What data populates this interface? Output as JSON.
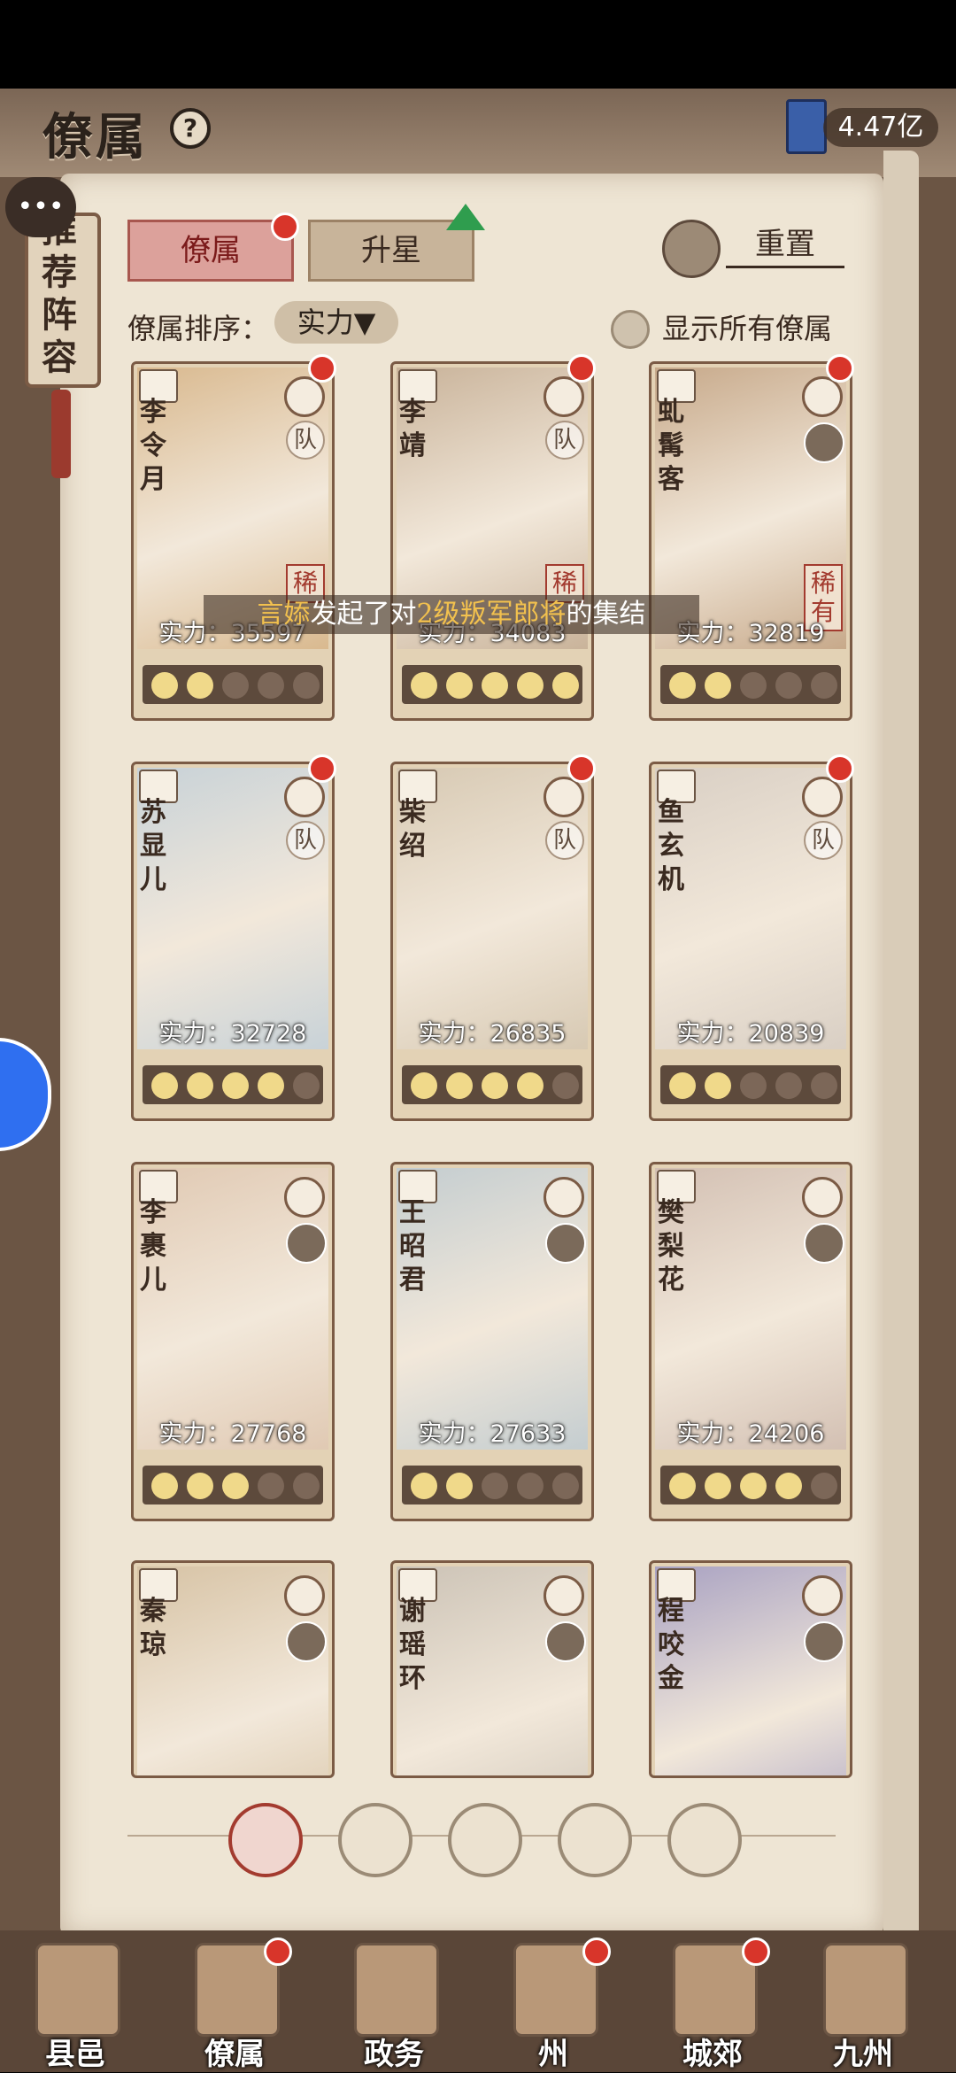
{
  "header": {
    "title": "僚属",
    "help_icon": "question-circle-icon",
    "currency_value": "4.47亿",
    "currency_icon": "book-icon"
  },
  "side": {
    "banner_text": "推荐阵容",
    "chat_icon": "chat-bubble-icon"
  },
  "tabs": [
    {
      "label": "僚属",
      "active": true
    },
    {
      "label": "升星",
      "active": false
    }
  ],
  "reset_label": "重置",
  "sort": {
    "label": "僚属排序：",
    "value": "实力▼"
  },
  "show_all_label": "显示所有僚属",
  "broadcast": {
    "user": "言婖",
    "mid1": "发起了对",
    "target": "2级叛军郎将",
    "mid2": "的集结"
  },
  "cards": [
    {
      "name": "李令月",
      "power": "实力：35597",
      "team": "队",
      "rare": "稀",
      "moons_on": 2,
      "bg": "#d9b98f"
    },
    {
      "name": "李靖",
      "power": "实力：34083",
      "team": "队",
      "rare": "稀",
      "moons_on": 5,
      "bg": "#c9b39a"
    },
    {
      "name": "虬髯客",
      "power": "实力：32819",
      "team": "",
      "rare": "稀有",
      "moons_on": 2,
      "bg": "#c7a98a"
    },
    {
      "name": "苏显儿",
      "power": "实力：32728",
      "team": "队",
      "rare": "",
      "moons_on": 4,
      "bg": "#c8d2d8"
    },
    {
      "name": "柴绍",
      "power": "实力：26835",
      "team": "队",
      "rare": "",
      "moons_on": 4,
      "bg": "#d7c9b3"
    },
    {
      "name": "鱼玄机",
      "power": "实力：20839",
      "team": "队",
      "rare": "",
      "moons_on": 2,
      "bg": "#d9cfc4"
    },
    {
      "name": "李裹儿",
      "power": "实力：27768",
      "team": "",
      "rare": "",
      "moons_on": 3,
      "bg": "#e0c9b3"
    },
    {
      "name": "王昭君",
      "power": "实力：27633",
      "team": "",
      "rare": "",
      "moons_on": 2,
      "bg": "#c4cdd0"
    },
    {
      "name": "樊梨花",
      "power": "实力：24206",
      "team": "",
      "rare": "",
      "moons_on": 4,
      "bg": "#d3c0b3"
    },
    {
      "name": "秦琼",
      "power": "",
      "team": "",
      "rare": "",
      "moons_on": 0,
      "bg": "#d7c3a5"
    },
    {
      "name": "谢瑶环",
      "power": "",
      "team": "",
      "rare": "",
      "moons_on": 0,
      "bg": "#ccc3b6"
    },
    {
      "name": "程咬金",
      "power": "",
      "team": "",
      "rare": "",
      "moons_on": 0,
      "bg": "#a9a2c2"
    }
  ],
  "filters": [
    "all-filter-icon",
    "crest-a-icon",
    "crest-b-icon",
    "fan-icon",
    "crest-c-icon"
  ],
  "nav": [
    {
      "label": "县邑",
      "icon": "gate-icon",
      "badge": false
    },
    {
      "label": "僚属",
      "icon": "scroll-cards-icon",
      "badge": true
    },
    {
      "label": "政务",
      "icon": "documents-icon",
      "badge": false
    },
    {
      "label": "州",
      "icon": "mountain-icon",
      "badge": true
    },
    {
      "label": "城郊",
      "icon": "cart-icon",
      "badge": true
    },
    {
      "label": "九州",
      "icon": "map-scroll-icon",
      "badge": false
    }
  ]
}
